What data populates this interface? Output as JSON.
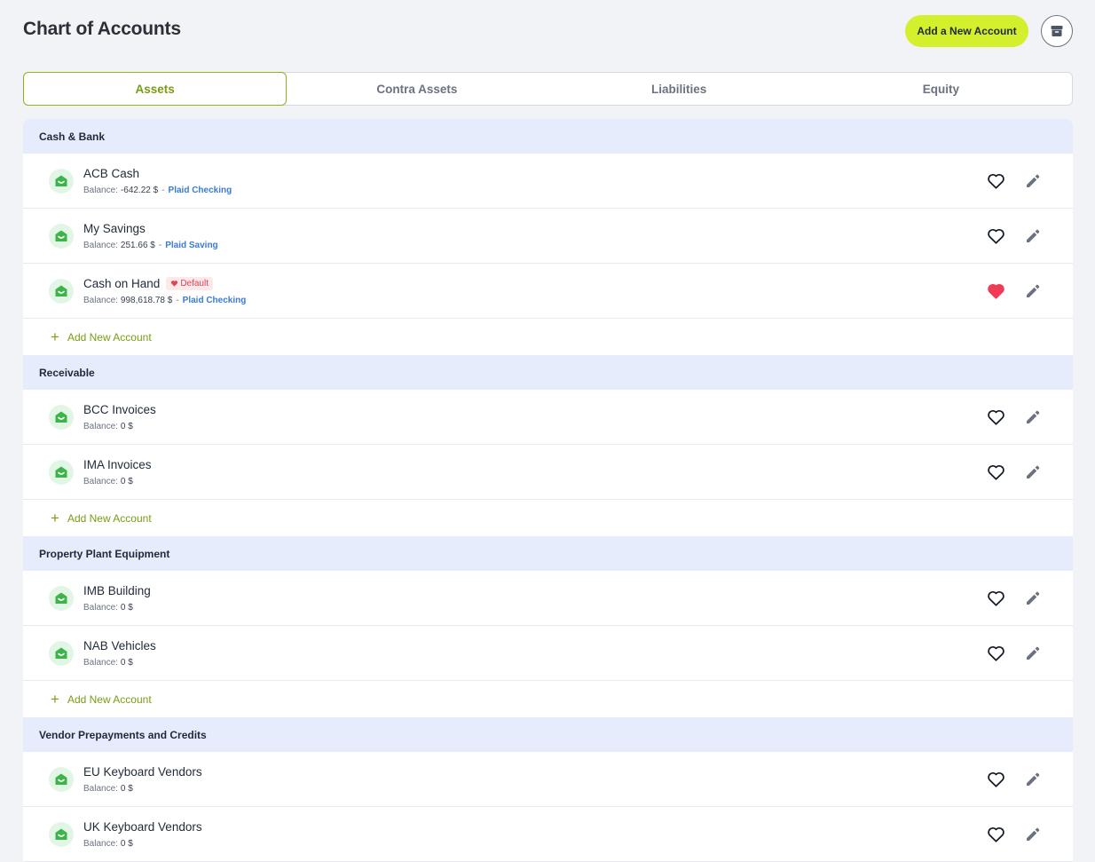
{
  "header": {
    "title": "Chart of Accounts",
    "add_account_label": "Add a New Account"
  },
  "tabs": [
    {
      "label": "Assets",
      "active": true
    },
    {
      "label": "Contra Assets",
      "active": false
    },
    {
      "label": "Liabilities",
      "active": false
    },
    {
      "label": "Equity",
      "active": false
    }
  ],
  "labels": {
    "balance": "Balance:",
    "default": "Default",
    "add_new_account": "Add New Account"
  },
  "sections": [
    {
      "title": "Cash & Bank",
      "accounts": [
        {
          "name": "ACB Cash",
          "balance": "-642.22 $",
          "link": "Plaid Checking",
          "favorite": false,
          "is_default": false
        },
        {
          "name": "My Savings",
          "balance": "251.66 $",
          "link": "Plaid Saving",
          "favorite": false,
          "is_default": false
        },
        {
          "name": "Cash on Hand",
          "balance": "998,618.78 $",
          "link": "Plaid Checking",
          "favorite": true,
          "is_default": true
        }
      ],
      "show_add": true
    },
    {
      "title": "Receivable",
      "accounts": [
        {
          "name": "BCC Invoices",
          "balance": "0 $",
          "link": "",
          "favorite": false,
          "is_default": false
        },
        {
          "name": "IMA Invoices",
          "balance": "0 $",
          "link": "",
          "favorite": false,
          "is_default": false
        }
      ],
      "show_add": true
    },
    {
      "title": "Property Plant Equipment",
      "accounts": [
        {
          "name": "IMB Building",
          "balance": "0 $",
          "link": "",
          "favorite": false,
          "is_default": false
        },
        {
          "name": "NAB Vehicles",
          "balance": "0 $",
          "link": "",
          "favorite": false,
          "is_default": false
        }
      ],
      "show_add": true
    },
    {
      "title": "Vendor Prepayments and Credits",
      "accounts": [
        {
          "name": "EU Keyboard Vendors",
          "balance": "0 $",
          "link": "",
          "favorite": false,
          "is_default": false
        },
        {
          "name": "UK Keyboard Vendors",
          "balance": "0 $",
          "link": "",
          "favorite": false,
          "is_default": false
        }
      ],
      "show_add": false
    }
  ],
  "colors": {
    "accent": "#d4ef2c",
    "accent_text": "#7a9c14",
    "section_bg": "#e6ecfb",
    "favorite": "#ef3b56",
    "link": "#3a7bd5",
    "icon_green": "#3cb44a"
  },
  "icons": {
    "archive": "archive-box-icon",
    "account": "bank-account-icon",
    "favorite": "heart-icon",
    "edit": "pencil-icon",
    "add": "plus-icon"
  }
}
